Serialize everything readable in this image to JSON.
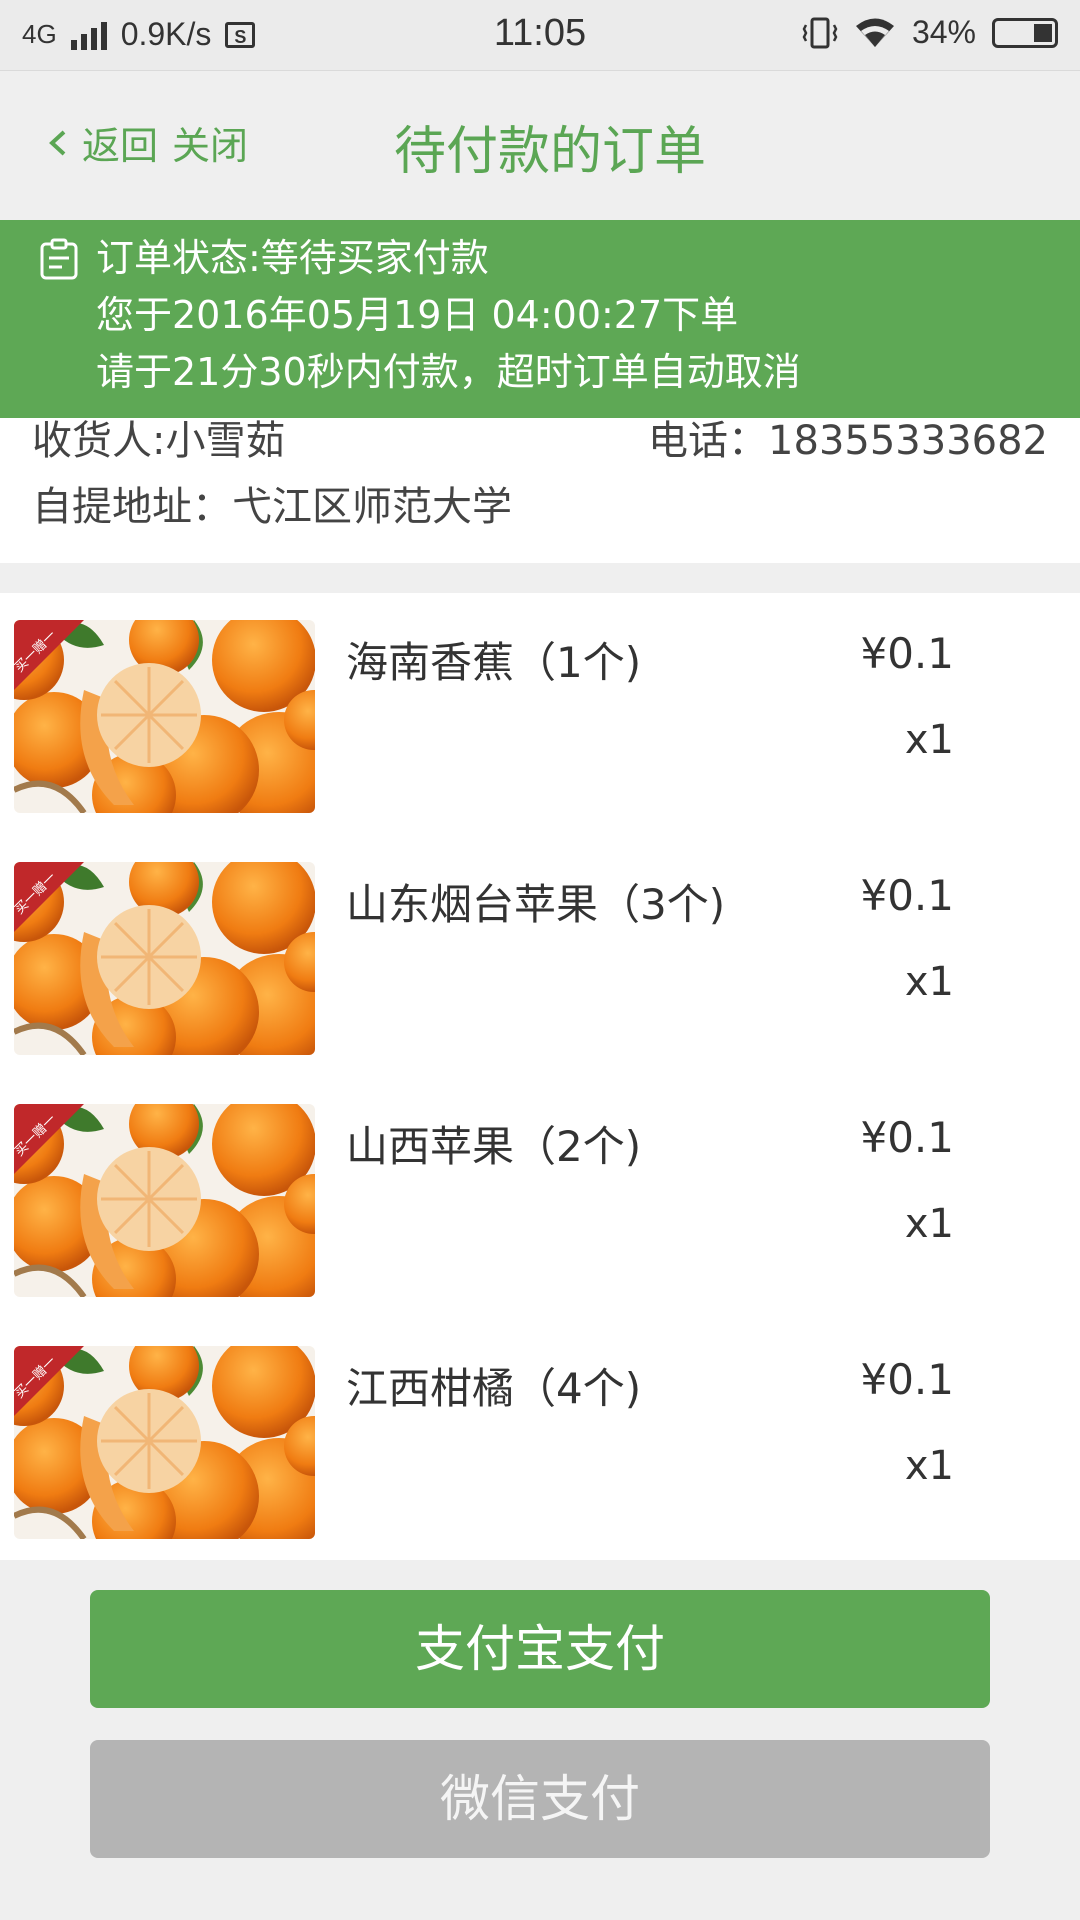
{
  "status_bar": {
    "network": "4G",
    "speed": "0.9K/s",
    "app_icon": "S",
    "time": "11:05",
    "battery": "34%",
    "icons": [
      "signal-icon",
      "vibrate-icon",
      "wifi-icon",
      "battery-icon"
    ]
  },
  "nav": {
    "back_label": "返回",
    "close_label": "关闭",
    "title": "待付款的订单"
  },
  "banner": {
    "status_text": "订单状态:等待买家付款",
    "order_time_text": "您于2016年05月19日 04:00:27下单",
    "countdown_text": "请于21分30秒内付款，超时订单自动取消"
  },
  "receiver": {
    "name_text": "收货人:小雪茹",
    "phone_text": "电话：18355333682",
    "address_text": "自提地址：弋江区师范大学"
  },
  "items": [
    {
      "name": "海南香蕉（1个)",
      "price": "¥0.1",
      "qty": "x1",
      "badge": "买一赠一"
    },
    {
      "name": "山东烟台苹果（3个)",
      "price": "¥0.1",
      "qty": "x1",
      "badge": "买一赠一"
    },
    {
      "name": "山西苹果（2个)",
      "price": "¥0.1",
      "qty": "x1",
      "badge": "买一赠一"
    },
    {
      "name": "江西柑橘（4个)",
      "price": "¥0.1",
      "qty": "x1",
      "badge": "买一赠一"
    }
  ],
  "buttons": {
    "alipay": "支付宝支付",
    "wechat": "微信支付"
  },
  "colors": {
    "accent": "#5ea855",
    "disabled": "#b4b4b4"
  }
}
